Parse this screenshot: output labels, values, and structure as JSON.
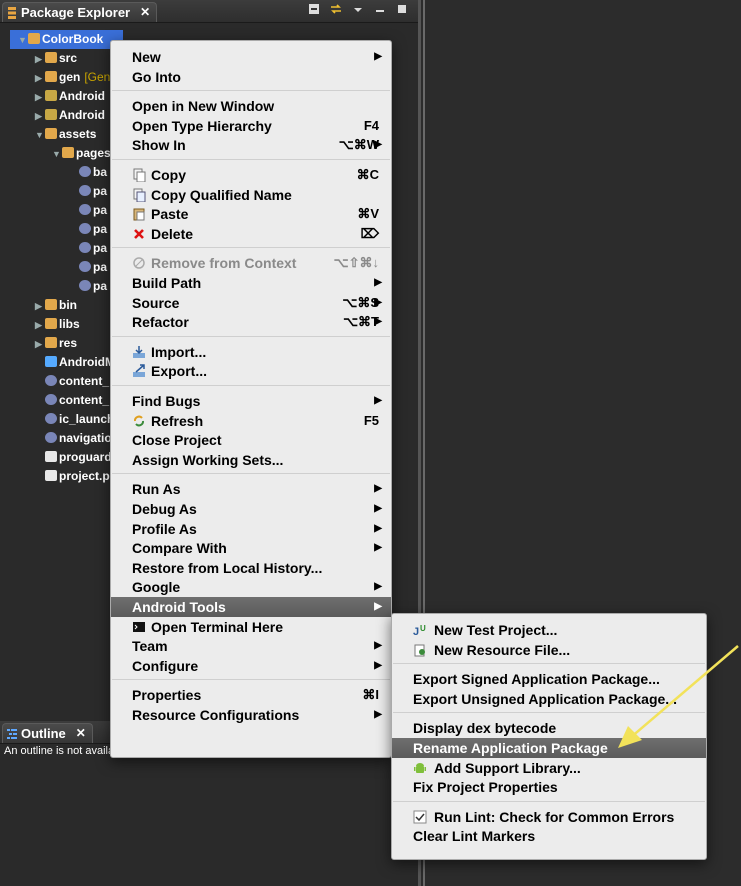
{
  "package_explorer": {
    "tab_title": "Package Explorer",
    "close_glyph": "✕",
    "tree": [
      {
        "label": "ColorBook",
        "icon": "project-folder-icon",
        "expander": "▼",
        "selected": true,
        "indent": 0
      },
      {
        "label": "src",
        "icon": "source-folder-icon",
        "expander": "▶",
        "indent": 1
      },
      {
        "label": "gen",
        "suffix": "[Gen",
        "icon": "source-folder-icon",
        "expander": "▶",
        "indent": 1
      },
      {
        "label": "Android",
        "icon": "android-library-icon",
        "expander": "▶",
        "indent": 1
      },
      {
        "label": "Android",
        "icon": "android-library-icon",
        "expander": "▶",
        "indent": 1
      },
      {
        "label": "assets",
        "icon": "folder-icon",
        "expander": "▼",
        "indent": 1
      },
      {
        "label": "pages",
        "icon": "folder-icon",
        "expander": "▼",
        "indent": 2
      },
      {
        "label": "ba",
        "icon": "image-file-icon",
        "expander": "",
        "indent": 3
      },
      {
        "label": "pa",
        "icon": "image-file-icon",
        "expander": "",
        "indent": 3
      },
      {
        "label": "pa",
        "icon": "image-file-icon",
        "expander": "",
        "indent": 3
      },
      {
        "label": "pa",
        "icon": "image-file-icon",
        "expander": "",
        "indent": 3
      },
      {
        "label": "pa",
        "icon": "image-file-icon",
        "expander": "",
        "indent": 3
      },
      {
        "label": "pa",
        "icon": "image-file-icon",
        "expander": "",
        "indent": 3
      },
      {
        "label": "pa",
        "icon": "image-file-icon",
        "expander": "",
        "indent": 3
      },
      {
        "label": "bin",
        "icon": "folder-icon",
        "expander": "▶",
        "indent": 1
      },
      {
        "label": "libs",
        "icon": "folder-icon",
        "expander": "▶",
        "indent": 1
      },
      {
        "label": "res",
        "icon": "folder-icon",
        "expander": "▶",
        "indent": 1
      },
      {
        "label": "AndroidM",
        "icon": "xml-file-icon",
        "expander": "",
        "indent": 1
      },
      {
        "label": "content_",
        "icon": "image-file-icon",
        "expander": "",
        "indent": 1
      },
      {
        "label": "content_",
        "icon": "image-file-icon",
        "expander": "",
        "indent": 1
      },
      {
        "label": "ic_launch",
        "icon": "image-file-icon",
        "expander": "",
        "indent": 1
      },
      {
        "label": "navigatio",
        "icon": "image-file-icon",
        "expander": "",
        "indent": 1
      },
      {
        "label": "proguard",
        "icon": "text-file-icon",
        "expander": "",
        "indent": 1
      },
      {
        "label": "project.p",
        "icon": "text-file-icon",
        "expander": "",
        "indent": 1
      }
    ]
  },
  "outline": {
    "tab_title": "Outline",
    "close_glyph": "✕",
    "message": "An outline is not available."
  },
  "context_menu": {
    "items": [
      {
        "label": "New",
        "submenu": true
      },
      {
        "label": "Go Into"
      },
      {
        "separator": true
      },
      {
        "label": "Open in New Window"
      },
      {
        "label": "Open Type Hierarchy",
        "shortcut": "F4"
      },
      {
        "label": "Show In",
        "shortcut": "⌥⌘W",
        "submenu": true
      },
      {
        "separator": true
      },
      {
        "label": "Copy",
        "shortcut": "⌘C",
        "icon": "copy-icon"
      },
      {
        "label": "Copy Qualified Name",
        "icon": "copy-qualified-name-icon"
      },
      {
        "label": "Paste",
        "shortcut": "⌘V",
        "icon": "paste-icon"
      },
      {
        "label": "Delete",
        "shortcut": "⌦",
        "icon": "delete-icon"
      },
      {
        "separator": true
      },
      {
        "label": "Remove from Context",
        "shortcut": "⌥⇧⌘↓",
        "icon": "remove-from-context-icon",
        "disabled": true
      },
      {
        "label": "Build Path",
        "submenu": true
      },
      {
        "label": "Source",
        "shortcut": "⌥⌘S",
        "submenu": true
      },
      {
        "label": "Refactor",
        "shortcut": "⌥⌘T",
        "submenu": true
      },
      {
        "separator": true
      },
      {
        "label": "Import...",
        "icon": "import-icon"
      },
      {
        "label": "Export...",
        "icon": "export-icon"
      },
      {
        "separator": true
      },
      {
        "label": "Find Bugs",
        "submenu": true
      },
      {
        "label": "Refresh",
        "shortcut": "F5",
        "icon": "refresh-icon"
      },
      {
        "label": "Close Project"
      },
      {
        "label": "Assign Working Sets..."
      },
      {
        "separator": true
      },
      {
        "label": "Run As",
        "submenu": true
      },
      {
        "label": "Debug As",
        "submenu": true
      },
      {
        "label": "Profile As",
        "submenu": true
      },
      {
        "label": "Compare With",
        "submenu": true
      },
      {
        "label": "Restore from Local History..."
      },
      {
        "label": "Google",
        "submenu": true
      },
      {
        "label": "Android Tools",
        "submenu": true,
        "highlighted": true
      },
      {
        "label": "Open Terminal Here",
        "icon": "terminal-icon"
      },
      {
        "label": "Team",
        "submenu": true
      },
      {
        "label": "Configure",
        "submenu": true
      },
      {
        "separator": true
      },
      {
        "label": "Properties",
        "shortcut": "⌘I"
      },
      {
        "label": "Resource Configurations",
        "submenu": true
      }
    ]
  },
  "android_tools_submenu": {
    "items": [
      {
        "label": "New Test Project...",
        "icon": "junit-test-icon"
      },
      {
        "label": "New Resource File...",
        "icon": "new-resource-file-icon"
      },
      {
        "separator": true
      },
      {
        "label": "Export Signed Application Package..."
      },
      {
        "label": "Export Unsigned Application Package..."
      },
      {
        "separator": true
      },
      {
        "label": "Display dex bytecode"
      },
      {
        "label": "Rename Application Package",
        "highlighted": true
      },
      {
        "label": "Add Support Library...",
        "icon": "android-icon"
      },
      {
        "label": "Fix Project Properties"
      },
      {
        "separator": true
      },
      {
        "label": "Run Lint: Check for Common Errors",
        "icon": "lint-check-icon"
      },
      {
        "label": "Clear Lint Markers"
      }
    ]
  },
  "colors": {
    "menu_bg": "#ececec",
    "menu_highlight": "#636363",
    "selection_blue": "#3a6fd8",
    "panel_bg": "#2a2a2a",
    "annotation_arrow": "#f2e25a"
  }
}
